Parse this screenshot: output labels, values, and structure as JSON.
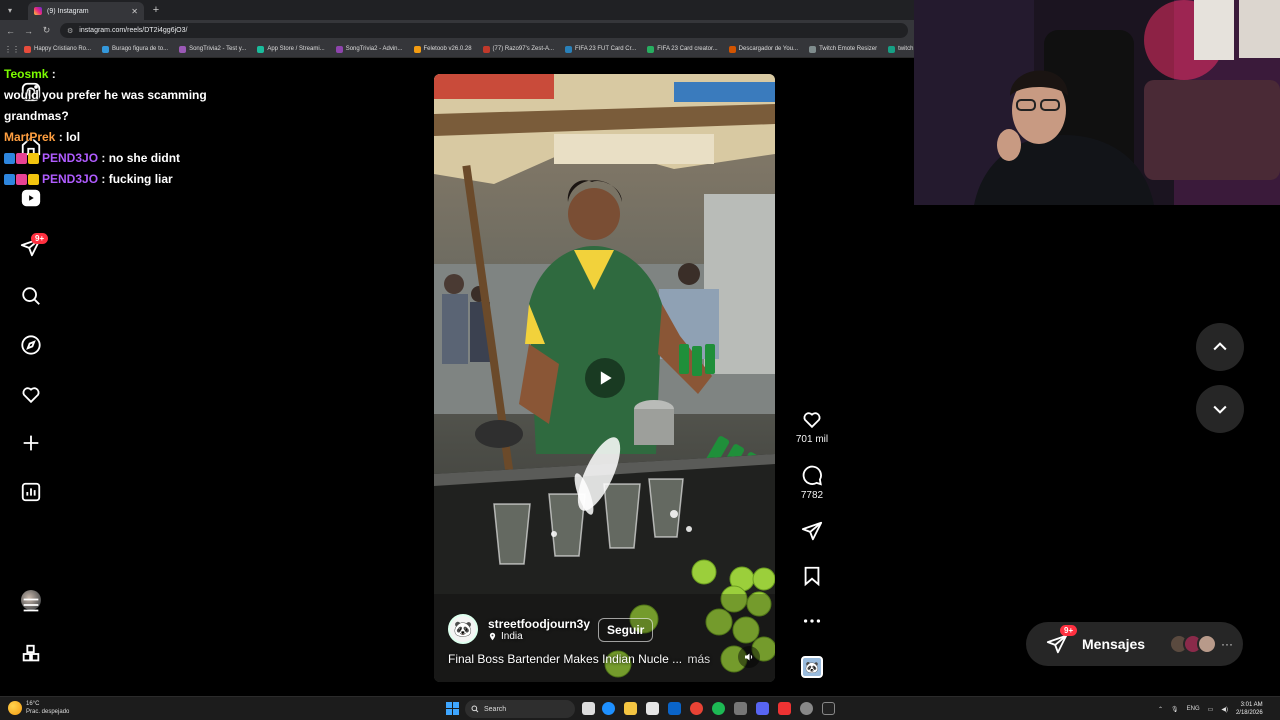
{
  "browser": {
    "tab_title": "(9) Instagram",
    "url": "instagram.com/reels/DT2i4gg6jO3/",
    "bookmarks": [
      "Happy Cristiano Ro...",
      "Burago figura de to...",
      "SongTrivia2 - Test y...",
      "App Store / Streami...",
      "SongTrivia2 - Advin...",
      "Feletoob v26.0.28",
      "(77) Razo97's Zest-A...",
      "FIFA 23 FUT Card Cr...",
      "FIFA 23 Card creator...",
      "Descargador de You...",
      "Twitch Emote Resizer",
      "twitch emote re..."
    ]
  },
  "chat": [
    {
      "user": "Teosmk",
      "color": "#7cfc00",
      "message": "would you prefer he was scamming grandmas?",
      "badges": []
    },
    {
      "user": "MartPrek",
      "color": "#ff9f40",
      "message": "lol",
      "badges": []
    },
    {
      "user": "PEND3JO",
      "color": "#b05cff",
      "message": "no she didnt",
      "badges": [
        "#2e86de",
        "#e84393",
        "#f1c40f"
      ]
    },
    {
      "user": "PEND3JO",
      "color": "#b05cff",
      "message": "fucking liar",
      "badges": [
        "#2e86de",
        "#e84393",
        "#f1c40f"
      ]
    }
  ],
  "nav": {
    "messages_badge": "9+",
    "icons": [
      "instagram-icon",
      "home-icon",
      "reels-icon",
      "messages-icon",
      "search-icon",
      "explore-icon",
      "notifications-icon",
      "create-icon",
      "dashboard-icon",
      "profile-icon",
      "menu-icon",
      "more-apps-icon"
    ]
  },
  "reel": {
    "username": "streetfoodjourn3y",
    "location": "India",
    "follow_label": "Seguir",
    "caption": "Final Boss Bartender Makes Indian Nucle ...",
    "more_label": "más"
  },
  "actions": {
    "likes": "701 mil",
    "comments": "7782"
  },
  "messages": {
    "label": "Mensajes",
    "badge": "9+"
  },
  "taskbar": {
    "weather_temp": "16°C",
    "weather_desc": "Prac. despejado",
    "search_placeholder": "Search",
    "lang": "ENG",
    "time": "3:01 AM",
    "date": "2/18/2026"
  },
  "colors": {
    "like_red": "#ff3040",
    "accent_blue": "#3ea6ff",
    "panel": "#262626"
  }
}
